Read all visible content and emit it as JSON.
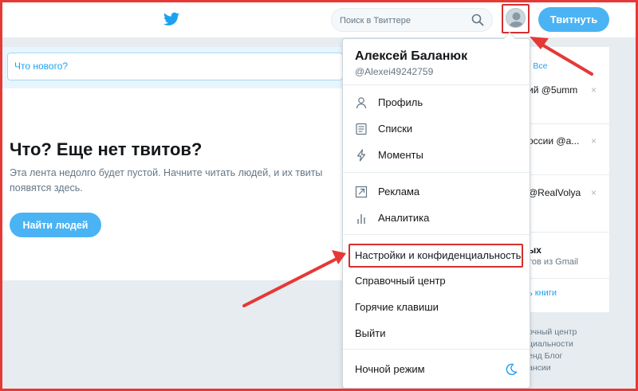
{
  "header": {
    "search_placeholder": "Поиск в Твиттере",
    "tweet_button": "Твитнуть"
  },
  "compose": {
    "placeholder": "Что нового?"
  },
  "empty_state": {
    "title": "Что? Еще нет твитов?",
    "description": "Эта лента недолго будет пустой. Начните читать людей, и их твиты появятся здесь.",
    "button": "Найти людей"
  },
  "right_column": {
    "header_links": "· Все",
    "items": [
      "ий @5umm",
      "оссии @a...",
      "@RealVolya"
    ],
    "contacts_title": "ых",
    "contacts_sub": "тов из Gmail",
    "books_link": "ь книги",
    "footer_lines": [
      "очный центр",
      "циальности",
      "енд  Блог",
      "ансии"
    ],
    "close_glyph": "×"
  },
  "menu": {
    "user_name": "Алексей Баланюк",
    "user_handle": "@Alexei49242759",
    "group1": [
      {
        "label": "Профиль",
        "icon": "user-icon"
      },
      {
        "label": "Списки",
        "icon": "list-icon"
      },
      {
        "label": "Моменты",
        "icon": "lightning-icon"
      }
    ],
    "group2": [
      {
        "label": "Реклама",
        "icon": "external-link-icon"
      },
      {
        "label": "Аналитика",
        "icon": "analytics-icon"
      }
    ],
    "group3": [
      {
        "label": "Настройки и конфиденциальность"
      },
      {
        "label": "Справочный центр"
      },
      {
        "label": "Горячие клавиши"
      },
      {
        "label": "Выйти"
      }
    ],
    "night_mode": "Ночной режим"
  },
  "colors": {
    "brand": "#1da1f2",
    "button": "#4ab3f4",
    "annotation_red": "#e53935"
  }
}
